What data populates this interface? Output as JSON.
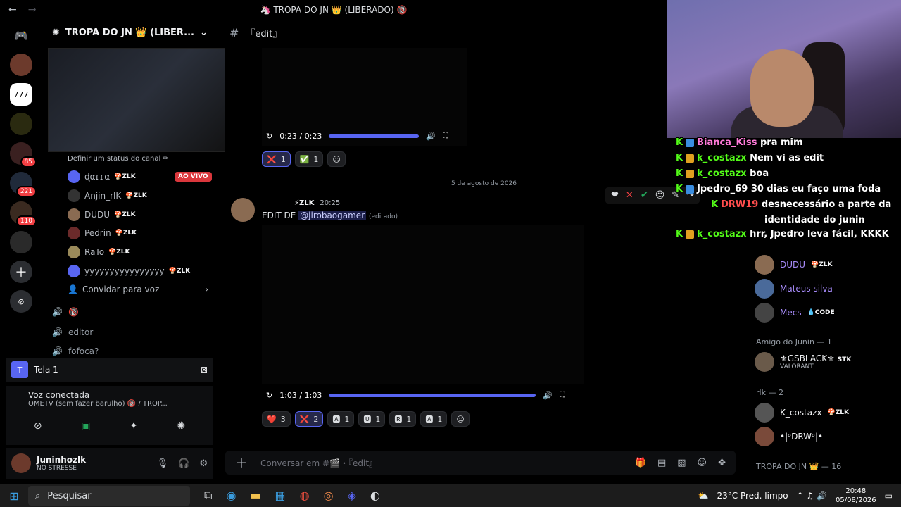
{
  "window": {
    "title": "🦄 TROPA DO JN 👑 (LIBERADO) 🔞",
    "back": "←",
    "forward": "→"
  },
  "server": {
    "name": "TROPA DO JN 👑 (LIBER...",
    "badges": [
      "85",
      "221",
      "110"
    ]
  },
  "channel": {
    "name": "『edit』",
    "status_link": "Definir um status do canal ✏",
    "live_label": "AO VIVO"
  },
  "voice_users": [
    {
      "name": "ɖαɾɾα",
      "tag": "🍄ZLK"
    },
    {
      "name": "Anjin_rlK",
      "tag": "🍄ZLK"
    },
    {
      "name": "DUDU",
      "tag": "🍄ZLK"
    },
    {
      "name": "Pedrin",
      "tag": "🍄ZLK"
    },
    {
      "name": "RaTo",
      "tag": "🍄ZLK"
    },
    {
      "name": "yyyyyyyyyyyyyyyy",
      "tag": "🍄ZLK"
    }
  ],
  "invite_voice": "Convidar para voz",
  "voice_channels": [
    "🔞",
    "editor",
    "fofoca?"
  ],
  "screenshare": {
    "label": "Tela 1"
  },
  "voice": {
    "connected": "Voz conectada",
    "server": "OMETV (sem fazer barulho) 🔞 / TROP..."
  },
  "user": {
    "name": "Juninhozlk",
    "status": "NO STRESSE"
  },
  "video1": {
    "time": "0:23 / 0:23",
    "progress": 1.0
  },
  "reactions1": [
    {
      "emoji": "❌",
      "count": "1",
      "me": true
    },
    {
      "emoji": "✅",
      "count": "1",
      "me": false
    }
  ],
  "date_divider": "5 de agosto de 2026",
  "message": {
    "tag": "⚡ZLK",
    "time": "20:25",
    "text": "EDIT DE ",
    "mention": "@jirobaogamer",
    "edited": "(editado)"
  },
  "video2": {
    "time": "1:03 / 1:03",
    "progress": 1.0
  },
  "reactions2": [
    {
      "emoji": "❤️",
      "count": "3",
      "me": false
    },
    {
      "emoji": "❌",
      "count": "2",
      "me": true
    },
    {
      "emoji": "🅰",
      "count": "1",
      "me": false
    },
    {
      "emoji": "🆄",
      "count": "1",
      "me": false
    },
    {
      "emoji": "🆁",
      "count": "1",
      "me": false
    },
    {
      "emoji": "🅰",
      "count": "1",
      "me": false
    }
  ],
  "composer": {
    "placeholder": "Conversar em #🎬・『edit』"
  },
  "members": {
    "online_users": [
      {
        "name": "DUDU",
        "tag": "🍄ZLK",
        "color": "#a78bfa"
      },
      {
        "name": "Mateus silva",
        "tag": "",
        "color": "#a78bfa"
      },
      {
        "name": "Mecs",
        "tag": "💧CODE",
        "color": "#a78bfa"
      }
    ],
    "cat_amigo": "Amigo do Junin — 1",
    "amigo_user": {
      "name": "⚜GSBLACK⚜",
      "tag": "STK",
      "sub": "VALORANT"
    },
    "cat_rlk": "rlk — 2",
    "rlk_users": [
      {
        "name": "K_costazx",
        "tag": "🍄ZLK"
      },
      {
        "name": "•|ᵒDRWᵒ|•",
        "tag": ""
      }
    ],
    "cat_tropa": "TROPA DO JN 👑 — 16"
  },
  "twitch_chat": [
    {
      "user": "Bianca_Kiss",
      "msg": "pra mim",
      "color": "#ff7ad9"
    },
    {
      "user": "k_costazx",
      "msg": "Nem vi as edit",
      "color": "#53fc18"
    },
    {
      "user": "k_costazx",
      "msg": "boa",
      "color": "#53fc18"
    },
    {
      "user": "Jpedro_69",
      "msg": "30 dias eu faço uma foda",
      "color": "#ffffff"
    },
    {
      "user": "DRW19",
      "msg": "desnecessário a parte da",
      "color": "#ff4d4d"
    },
    {
      "user": "",
      "msg": "identidade do junin",
      "color": "#ffffff"
    },
    {
      "user": "k_costazx",
      "msg": "hrr, Jpedro leva fácil, KKKK",
      "color": "#53fc18"
    }
  ],
  "taskbar": {
    "search": "Pesquisar",
    "weather": "23°C Pred. limpo",
    "time": "20:48",
    "date": "05/08/2026"
  }
}
